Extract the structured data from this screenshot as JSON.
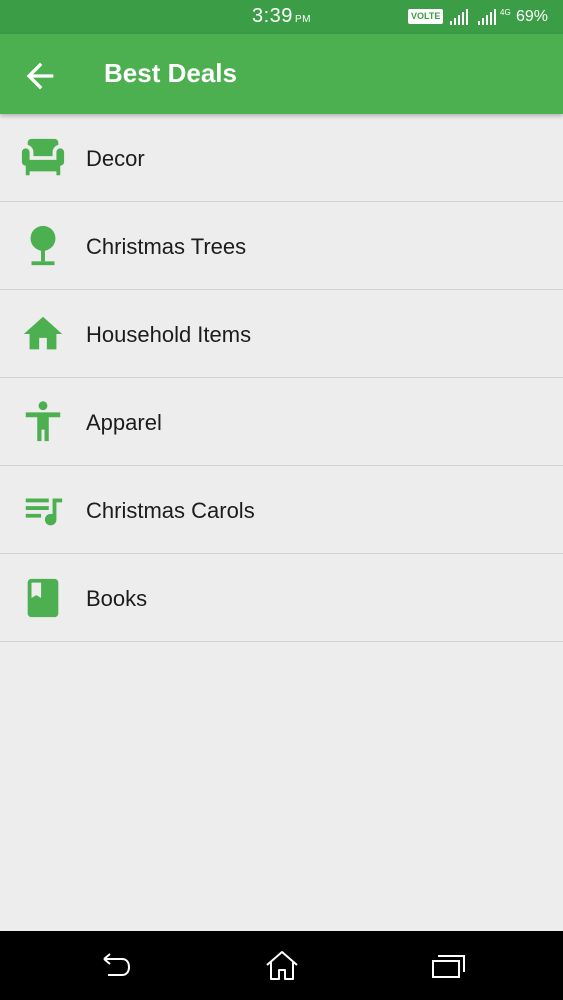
{
  "status_bar": {
    "time": "3:39",
    "ampm": "PM",
    "volte": "VOLTE",
    "network_type": "4G",
    "battery": "69%"
  },
  "app_bar": {
    "title": "Best Deals",
    "back_icon": "arrow-back-icon"
  },
  "categories": [
    {
      "label": "Decor",
      "icon": "armchair-icon"
    },
    {
      "label": "Christmas Trees",
      "icon": "tree-icon"
    },
    {
      "label": "Household Items",
      "icon": "home-icon"
    },
    {
      "label": "Apparel",
      "icon": "person-icon"
    },
    {
      "label": "Christmas Carols",
      "icon": "playlist-music-icon"
    },
    {
      "label": "Books",
      "icon": "book-icon"
    }
  ],
  "nav_bar": {
    "back": "back-icon",
    "home": "home-icon",
    "recents": "recents-icon"
  },
  "colors": {
    "status_bar": "#3b9d46",
    "app_bar": "#4caf50",
    "icon": "#4caf50",
    "background": "#eeedee"
  }
}
